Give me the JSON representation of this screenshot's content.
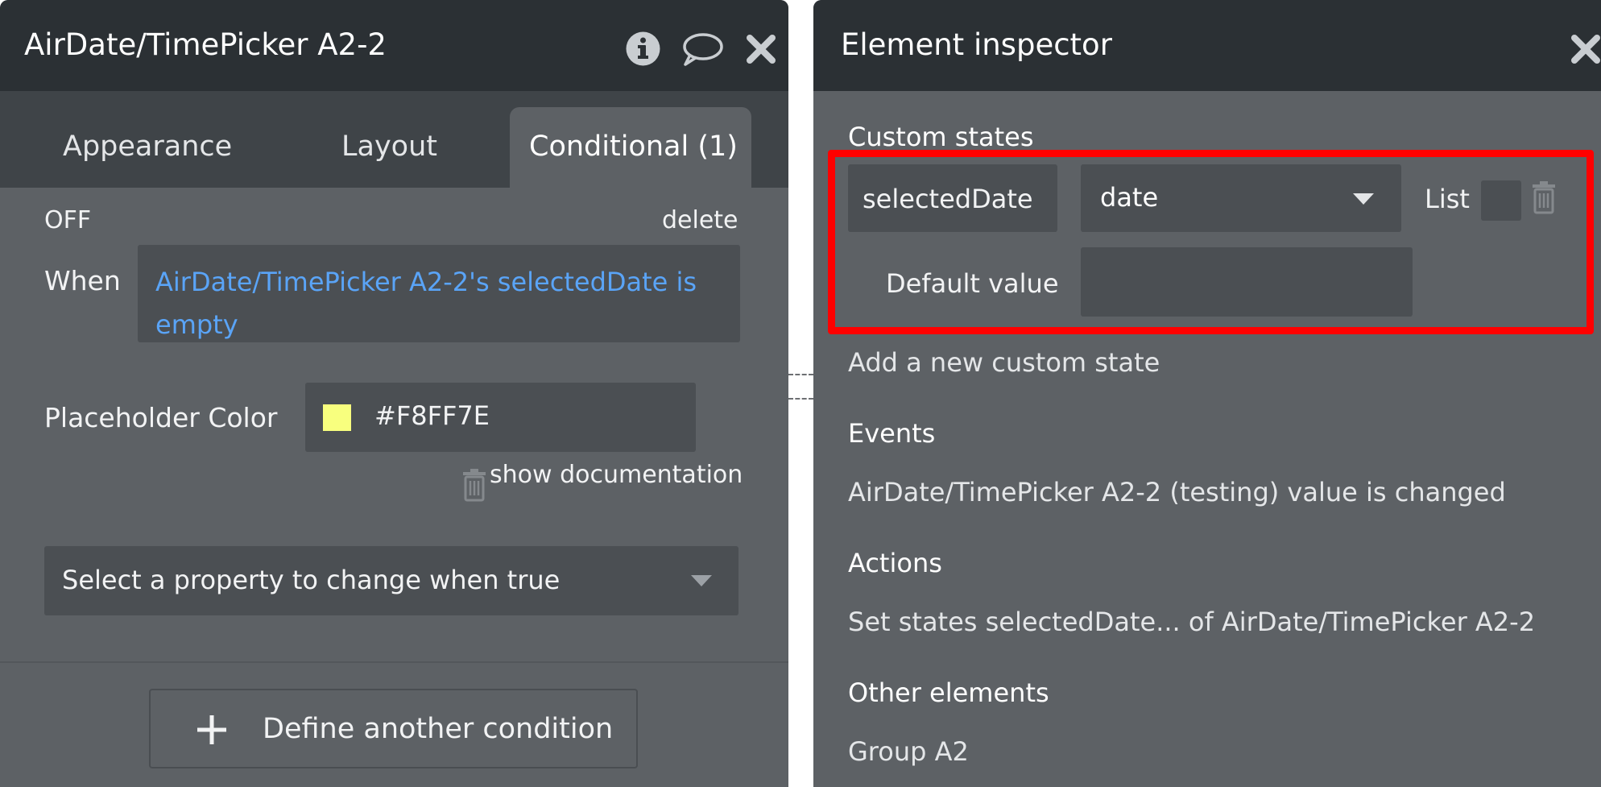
{
  "left": {
    "title": "AirDate/TimePicker A2-2",
    "tabs": [
      {
        "label": "Appearance"
      },
      {
        "label": "Layout"
      },
      {
        "label": "Conditional (1)"
      }
    ],
    "condition": {
      "status": "OFF",
      "delete_label": "delete",
      "when_label": "When",
      "when_expression": "AirDate/TimePicker A2-2's selectedDate is empty",
      "property_label": "Placeholder Color",
      "property_value": "#F8FF7E",
      "swatch_color": "#F8FF7E",
      "show_docs_label": "show documentation",
      "select_placeholder": "Select a property to change when true"
    },
    "define_button": {
      "label": "Define another condition"
    }
  },
  "right": {
    "title": "Element inspector",
    "custom_states": {
      "heading": "Custom states",
      "state_name": "selectedDate",
      "state_type": "date",
      "list_label": "List",
      "default_value_label": "Default value",
      "default_value": "",
      "add_label": "Add a new custom state"
    },
    "events": {
      "heading": "Events",
      "items": [
        "AirDate/TimePicker A2-2 (testing) value is changed"
      ]
    },
    "actions": {
      "heading": "Actions",
      "items": [
        "Set states selectedDate... of AirDate/TimePicker A2-2"
      ]
    },
    "other_elements": {
      "heading": "Other elements",
      "items": [
        "Group A2"
      ]
    }
  },
  "colors": {
    "panel_bg": "#5d6165",
    "titlebar_bg": "#2b3034",
    "field_bg": "#4b4f53",
    "link_blue": "#5aa4f7",
    "highlight_red": "#ff0000"
  }
}
